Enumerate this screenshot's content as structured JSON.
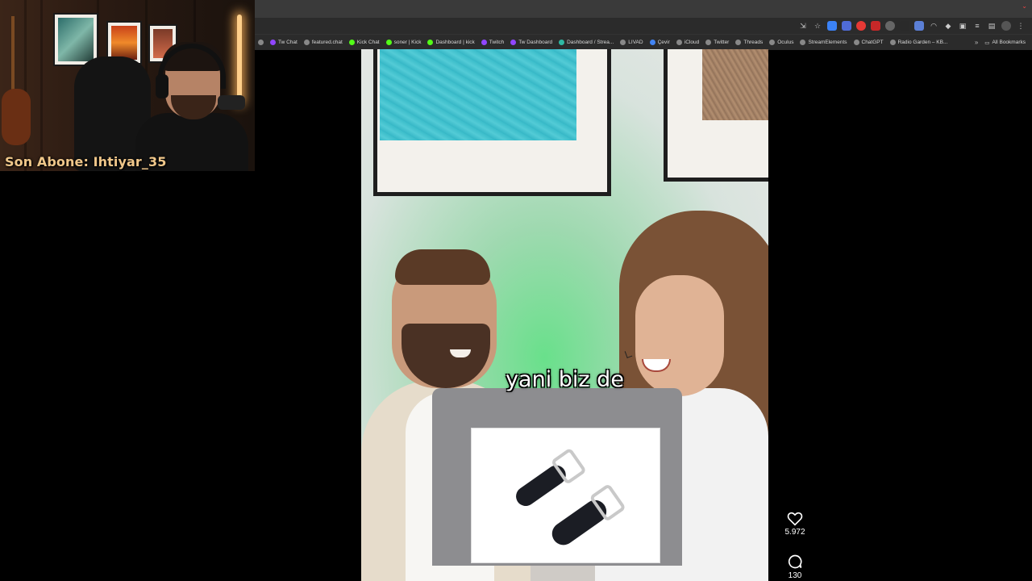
{
  "webcam": {
    "label": "Son Abone: Ihtiyar_35"
  },
  "bookmarks": [
    {
      "label": "Tw Chat",
      "color": "#9146ff"
    },
    {
      "label": "featured.chat",
      "color": "#888888"
    },
    {
      "label": "Kick Chat",
      "color": "#53fc18"
    },
    {
      "label": "soner | Kick",
      "color": "#53fc18"
    },
    {
      "label": "Dashboard | kick",
      "color": "#53fc18"
    },
    {
      "label": "Twitch",
      "color": "#9146ff"
    },
    {
      "label": "Tw Dashboard",
      "color": "#9146ff"
    },
    {
      "label": "Dashboard / Strea...",
      "color": "#2fb8a3"
    },
    {
      "label": "LIVAD",
      "color": "#888888"
    },
    {
      "label": "Çevir",
      "color": "#4285f4"
    },
    {
      "label": "iCloud",
      "color": "#888888"
    },
    {
      "label": "Twitter",
      "color": "#888888"
    },
    {
      "label": "Threads",
      "color": "#888888"
    },
    {
      "label": "Oculus",
      "color": "#888888"
    },
    {
      "label": "StreamElements",
      "color": "#888888"
    },
    {
      "label": "ChatGPT",
      "color": "#888888"
    },
    {
      "label": "Radio Garden – KB...",
      "color": "#888888"
    }
  ],
  "bookmarks_more": "»",
  "all_bookmarks": "All Bookmarks",
  "video": {
    "caption": "yani biz de",
    "likes": "5.972",
    "comments": "130"
  },
  "icons": {
    "like": "heart-icon",
    "comment": "comment-icon",
    "star": "star-icon",
    "folder": "folder-icon"
  },
  "colors": {
    "webcam_label": "#f0c78a",
    "chrome_bg": "#2b2b2b"
  }
}
